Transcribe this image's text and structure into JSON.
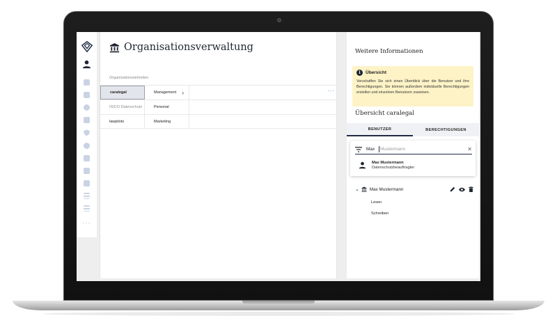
{
  "sidebar": {
    "nav": [
      {
        "name": "dashboard-icon"
      },
      {
        "name": "inbox-icon"
      },
      {
        "name": "bell-icon"
      },
      {
        "name": "document-icon"
      },
      {
        "name": "shield-icon"
      },
      {
        "name": "settings-icon"
      },
      {
        "name": "building-icon"
      },
      {
        "name": "chat-icon"
      },
      {
        "name": "lock-icon"
      },
      {
        "name": "list-icon"
      },
      {
        "name": "checklist-icon"
      }
    ],
    "more": "···"
  },
  "main": {
    "title": "Organisationsverwaltung",
    "section_label": "Organisationseinheiten",
    "rows": [
      {
        "unit": "caralegal",
        "sub": "Management"
      },
      {
        "unit": "ISICO Datenschutz",
        "sub": "Personal"
      },
      {
        "unit": "lawpilots",
        "sub": "Marketing"
      }
    ],
    "more_dots": "···"
  },
  "info": {
    "title": "Weitere Informationen",
    "alert": {
      "icon": "i",
      "title": "Übersicht",
      "text": "Verschaffen Sie sich einen Überblick über die Benutzer und ihre Berechtigungen. Sie können außerdem individuelle Berechtigungen erstellen und einzelnen Benutzern zuweisen."
    },
    "overview_title": "Übersicht caralegal",
    "tabs": [
      "BENUTZER",
      "BERECHTIGUNGEN"
    ],
    "search": {
      "value": "Max",
      "placeholder": "Mustermann"
    },
    "suggestion": {
      "name": "Max Mustermann",
      "role": "Datenschutzbeauftragter"
    },
    "tree": {
      "name": "Max Mustermann",
      "children": [
        "Lesen",
        "Schreiben"
      ]
    }
  },
  "colors": {
    "accent": "#1f2a44",
    "alert_bg": "#fdf3c7",
    "link": "#3b82f6"
  }
}
